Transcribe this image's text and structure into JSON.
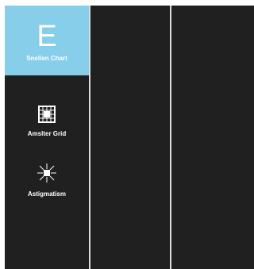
{
  "sidebar": {
    "items": [
      {
        "id": "snellen",
        "glyph": "E",
        "label": "Snellen Chart",
        "active": true
      },
      {
        "id": "amsler",
        "icon": "amsler-grid-icon",
        "label": "Amslter Grid",
        "active": false
      },
      {
        "id": "astig",
        "icon": "astigmatism-icon",
        "label": "Astigmatism",
        "active": false
      }
    ]
  },
  "colors": {
    "panel_bg": "#202020",
    "active_bg": "#87ceeb",
    "divider": "#dcdcdc"
  }
}
